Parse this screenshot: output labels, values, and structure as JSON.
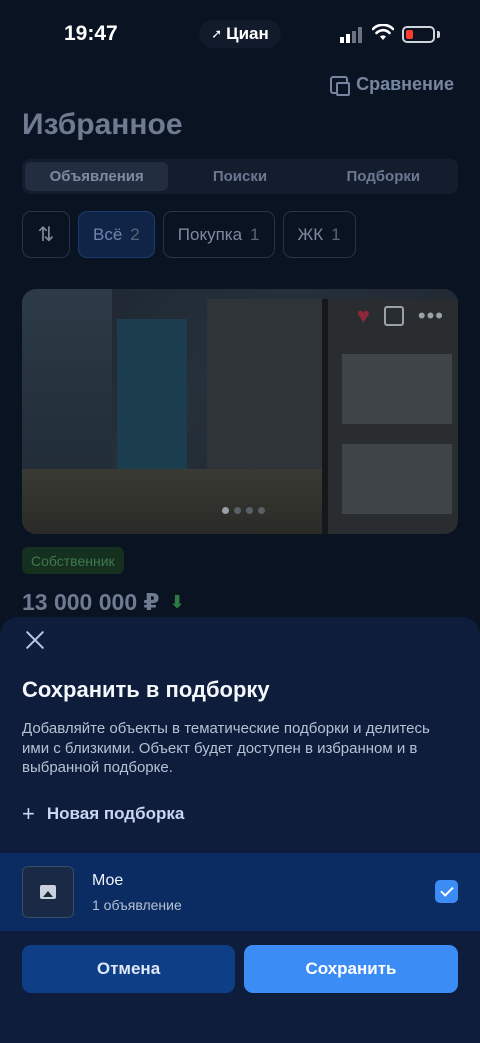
{
  "status_bar": {
    "time": "19:47",
    "app_pill": "Циан"
  },
  "header": {
    "compare_label": "Сравнение",
    "title": "Избранное"
  },
  "tabs": [
    {
      "label": "Объявления",
      "active": true
    },
    {
      "label": "Поиски",
      "active": false
    },
    {
      "label": "Подборки",
      "active": false
    }
  ],
  "filters": [
    {
      "label": "Всё",
      "count": "2",
      "active": true
    },
    {
      "label": "Покупка",
      "count": "1",
      "active": false
    },
    {
      "label": "ЖК",
      "count": "1",
      "active": false
    }
  ],
  "listing": {
    "badge": "Собственник",
    "price": "13 000 000 ₽"
  },
  "sheet": {
    "title": "Сохранить в подборку",
    "description": "Добавляйте объекты в тематические подборки и делитесь ими с близкими. Объект будет доступен в избранном и в выбранной подборке.",
    "new_collection": "Новая подборка",
    "collection": {
      "name": "Мое",
      "count": "1 объявление",
      "checked": true
    },
    "cancel_label": "Отмена",
    "save_label": "Сохранить"
  },
  "colors": {
    "accent": "#3b8cf5",
    "sheet_bg": "#0e1d3b",
    "selected_row": "#0a2c62"
  }
}
